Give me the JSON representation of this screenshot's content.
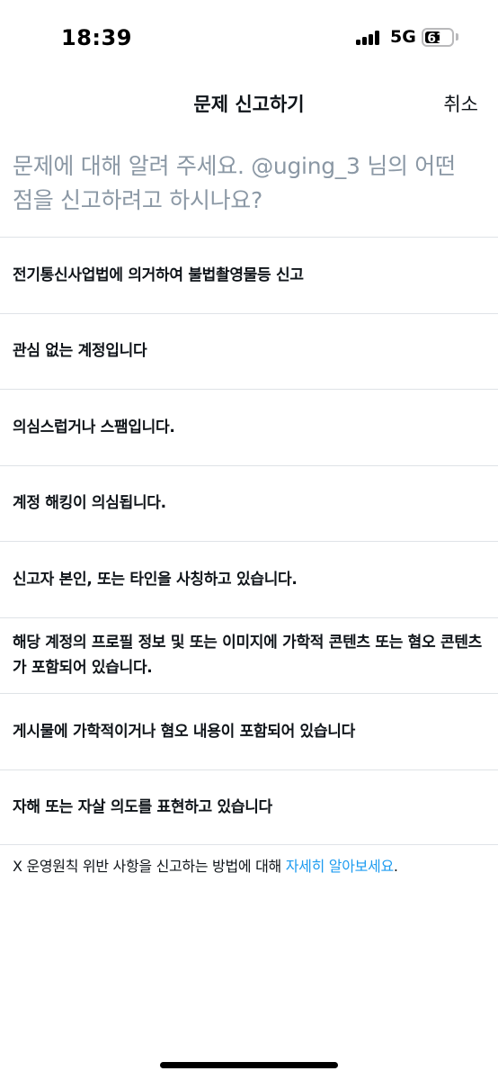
{
  "status_bar": {
    "time": "18:39",
    "network": "5G",
    "battery_level": "61"
  },
  "header": {
    "title": "문제 신고하기",
    "cancel_label": "취소"
  },
  "prompt": "문제에 대해 알려 주세요. @uging_3 님의 어떤 점을 신고하려고 하시나요?",
  "options": [
    {
      "label": "전기통신사업법에 의거하여 불법촬영물등 신고"
    },
    {
      "label": "관심 없는 계정입니다"
    },
    {
      "label": "의심스럽거나 스팸입니다."
    },
    {
      "label": "계정 해킹이 의심됩니다."
    },
    {
      "label": "신고자 본인, 또는 타인을 사칭하고 있습니다."
    },
    {
      "label": "해당 계정의 프로필 정보 및 또는 이미지에 가학적 콘텐츠 또는 혐오 콘텐츠가 포함되어 있습니다."
    },
    {
      "label": "게시물에 가학적이거나 혐오 내용이 포함되어 있습니다"
    },
    {
      "label": "자해 또는 자살 의도를 표현하고 있습니다"
    }
  ],
  "footer": {
    "text": "X 운영원칙 위반 사항을 신고하는 방법에 대해 ",
    "link": "자세히 알아보세요",
    "end": "."
  },
  "colors": {
    "link": "#1d9bf0",
    "prompt": "#8b98a5",
    "divider": "#dfe3e7"
  }
}
